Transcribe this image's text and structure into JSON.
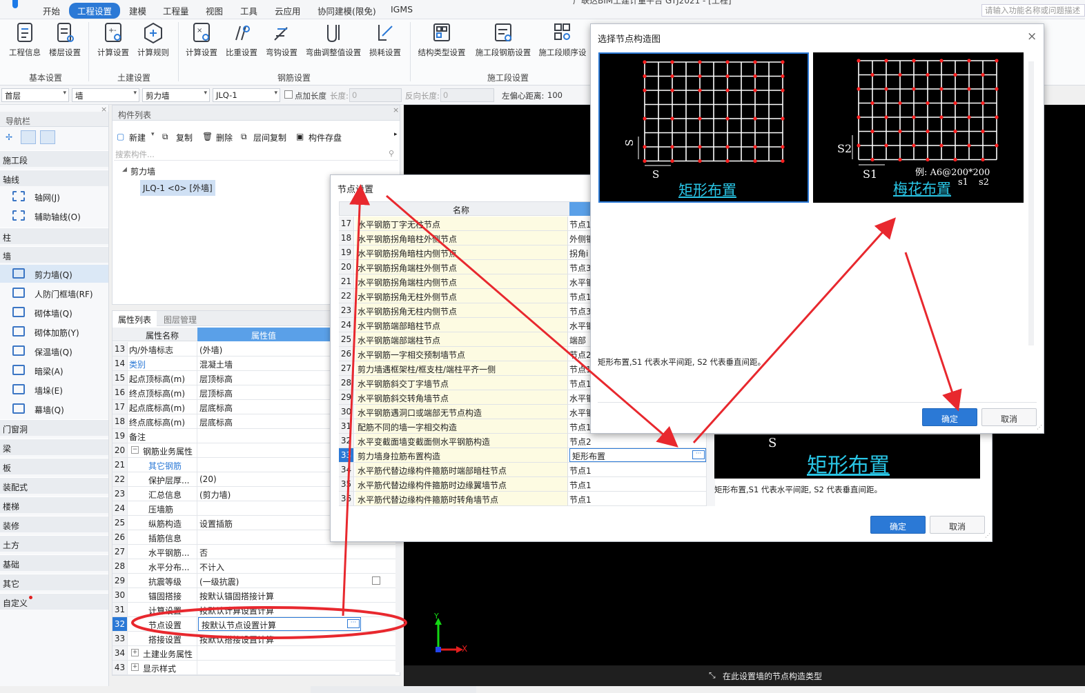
{
  "window": {
    "title": "广联达BIM土建计量平台 GTJ2021 - [工程]"
  },
  "menu": {
    "items": [
      "开始",
      "工程设置",
      "建模",
      "工程量",
      "视图",
      "工具",
      "云应用",
      "协同建模(限免)",
      "IGMS"
    ],
    "active_index": 1,
    "search_placeholder": "请输入功能名称或问题描述"
  },
  "ribbon": {
    "buttons": [
      "工程信息",
      "楼层设置",
      "计算设置",
      "计算规则",
      "计算设置",
      "比重设置",
      "弯钩设置",
      "弯曲调整值设置",
      "损耗设置",
      "结构类型设置",
      "施工段钢筋设置",
      "施工段顺序设"
    ],
    "groups": [
      "基本设置",
      "土建设置",
      "钢筋设置",
      "施工段设置"
    ]
  },
  "toolbar": {
    "floor": "首层",
    "category": "墙",
    "type": "剪力墙",
    "component": "JLQ-1",
    "checkbox_label": "点加长度",
    "length_label": "长度:",
    "length_value": "0",
    "reverse_label": "反向长度:",
    "reverse_value": "0",
    "offset_label": "左偏心距离:",
    "offset_value": "100"
  },
  "nav": {
    "title": "导航栏",
    "sections": [
      {
        "label": "施工段",
        "items": []
      },
      {
        "label": "轴线",
        "items": [
          "轴网(J)",
          "辅助轴线(O)"
        ]
      },
      {
        "label": "柱",
        "items": []
      },
      {
        "label": "墙",
        "items": [
          "剪力墙(Q)",
          "人防门框墙(RF)",
          "砌体墙(Q)",
          "砌体加筋(Y)",
          "保温墙(Q)",
          "暗梁(A)",
          "墙垛(E)",
          "幕墙(Q)"
        ]
      },
      {
        "label": "门窗洞",
        "items": []
      },
      {
        "label": "梁",
        "items": []
      },
      {
        "label": "板",
        "items": []
      },
      {
        "label": "装配式",
        "items": []
      },
      {
        "label": "楼梯",
        "items": []
      },
      {
        "label": "装修",
        "items": []
      },
      {
        "label": "土方",
        "items": []
      },
      {
        "label": "基础",
        "items": []
      },
      {
        "label": "其它",
        "items": []
      },
      {
        "label": "自定义",
        "items": []
      }
    ],
    "selected_item": "剪力墙(Q)"
  },
  "component_list": {
    "title": "构件列表",
    "actions": [
      "新建",
      "复制",
      "删除",
      "层间复制",
      "构件存盘"
    ],
    "search_placeholder": "搜索构件...",
    "tree_root": "剪力墙",
    "selected_component": "JLQ-1 <0> [外墙]"
  },
  "property_list": {
    "tabs": [
      "属性列表",
      "图层管理"
    ],
    "headers": [
      "属性名称",
      "属性值"
    ],
    "rows": [
      {
        "num": "13",
        "name": "内/外墙标志",
        "value": "(外墙)"
      },
      {
        "num": "14",
        "name": "类别",
        "value": "混凝土墙"
      },
      {
        "num": "15",
        "name": "起点顶标高(m)",
        "value": "层顶标高"
      },
      {
        "num": "16",
        "name": "终点顶标高(m)",
        "value": "层顶标高"
      },
      {
        "num": "17",
        "name": "起点底标高(m)",
        "value": "层底标高"
      },
      {
        "num": "18",
        "name": "终点底标高(m)",
        "value": "层底标高"
      },
      {
        "num": "19",
        "name": "备注",
        "value": ""
      },
      {
        "num": "20",
        "name": "钢筋业务属性",
        "value": ""
      },
      {
        "num": "21",
        "name": "其它钢筋",
        "value": ""
      },
      {
        "num": "22",
        "name": "保护层厚...",
        "value": "(20)"
      },
      {
        "num": "23",
        "name": "汇总信息",
        "value": "(剪力墙)"
      },
      {
        "num": "24",
        "name": "压墙筋",
        "value": ""
      },
      {
        "num": "25",
        "name": "纵筋构造",
        "value": "设置插筋"
      },
      {
        "num": "26",
        "name": "插筋信息",
        "value": ""
      },
      {
        "num": "27",
        "name": "水平钢筋...",
        "value": "否"
      },
      {
        "num": "28",
        "name": "水平分布...",
        "value": "不计入"
      },
      {
        "num": "29",
        "name": "抗震等级",
        "value": "(一级抗震)"
      },
      {
        "num": "30",
        "name": "锚固搭接",
        "value": "按默认锚固搭接计算"
      },
      {
        "num": "31",
        "name": "计算设置",
        "value": "按默认计算设置计算"
      },
      {
        "num": "32",
        "name": "节点设置",
        "value": "按默认节点设置计算"
      },
      {
        "num": "33",
        "name": "搭接设置",
        "value": "按默认搭接设置计算"
      },
      {
        "num": "34",
        "name": "土建业务属性",
        "value": ""
      },
      {
        "num": "43",
        "name": "显示样式",
        "value": ""
      }
    ]
  },
  "node_dialog": {
    "title": "节点设置",
    "header_name": "名称",
    "rows": [
      {
        "num": "17",
        "name": "水平钢筋丁字无柱节点",
        "value": "节点1"
      },
      {
        "num": "18",
        "name": "水平钢筋拐角暗柱外侧节点",
        "value": "外侧钢"
      },
      {
        "num": "19",
        "name": "水平钢筋拐角暗柱内侧节点",
        "value": "拐角i"
      },
      {
        "num": "20",
        "name": "水平钢筋拐角端柱外侧节点",
        "value": "节点3"
      },
      {
        "num": "21",
        "name": "水平钢筋拐角端柱内侧节点",
        "value": "水平钢"
      },
      {
        "num": "22",
        "name": "水平钢筋拐角无柱外侧节点",
        "value": "节点1"
      },
      {
        "num": "23",
        "name": "水平钢筋拐角无柱内侧节点",
        "value": "节点3"
      },
      {
        "num": "24",
        "name": "水平钢筋端部暗柱节点",
        "value": "水平钢"
      },
      {
        "num": "25",
        "name": "水平钢筋端部端柱节点",
        "value": "端部"
      },
      {
        "num": "26",
        "name": "水平钢筋一字相交预制墙节点",
        "value": "节点2"
      },
      {
        "num": "27",
        "name": "剪力墙遇框架柱/框支柱/端柱平齐一侧",
        "value": "节点1"
      },
      {
        "num": "28",
        "name": "水平钢筋斜交丁字墙节点",
        "value": "节点1"
      },
      {
        "num": "29",
        "name": "水平钢筋斜交转角墙节点",
        "value": "水平钢"
      },
      {
        "num": "30",
        "name": "水平钢筋遇洞口或端部无节点构造",
        "value": "水平钢"
      },
      {
        "num": "31",
        "name": "配筋不同的墙一字相交构造",
        "value": "节点1"
      },
      {
        "num": "32",
        "name": "水平变截面墙变截面侧水平钢筋构造",
        "value": "节点2"
      },
      {
        "num": "33",
        "name": "剪力墙身拉筋布置构造",
        "value": "矩形布置"
      },
      {
        "num": "34",
        "name": "水平筋代替边缘构件箍筋时端部暗柱节点",
        "value": "节点1"
      },
      {
        "num": "35",
        "name": "水平筋代替边缘构件箍筋时边缘翼墙节点",
        "value": "节点1"
      },
      {
        "num": "36",
        "name": "水平筋代替边缘构件箍筋时转角墙节点",
        "value": "节点1"
      }
    ],
    "selected_row": "33",
    "preview_caption": "矩形布置",
    "preview_s_label": "S",
    "description": "矩形布置,S1 代表水平间距, S2 代表垂直间距。",
    "ok": "确定",
    "cancel": "取消"
  },
  "select_dialog": {
    "title": "选择节点构造图",
    "options": [
      {
        "caption": "矩形布置",
        "labels": [
          "S",
          "S"
        ]
      },
      {
        "caption": "梅花布置",
        "labels": [
          "S2",
          "S1",
          "例: A6@200*200",
          "s1",
          "s2"
        ]
      }
    ],
    "selected_index": 0,
    "description": "矩形布置,S1 代表水平间距, S2 代表垂直间距。",
    "ok": "确定",
    "cancel": "取消"
  },
  "canvas": {
    "status_text": "在此设置墙的节点构造类型",
    "axis_x": "X",
    "axis_y": "Y"
  },
  "colors": {
    "accent": "#2b79d6",
    "annotation": "#e8282e",
    "preview_text": "#29c6e6"
  }
}
